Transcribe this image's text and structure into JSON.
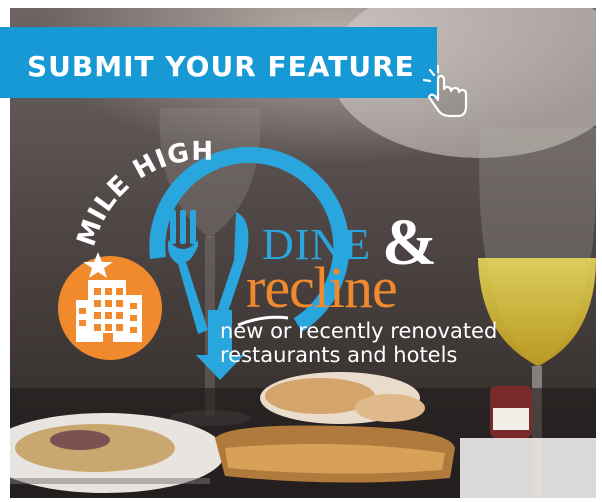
{
  "banner": {
    "title": "SUBMIT YOUR FEATURE",
    "color": "#1799d6"
  },
  "logo": {
    "arc_text": "MILE HIGH",
    "word_dine": "DINE",
    "word_amp": "&",
    "word_recline": "recline",
    "tagline_line1": "new or recently renovated",
    "tagline_line2": "restaurants and hotels",
    "colors": {
      "blue": "#2aa6de",
      "orange": "#f08a2c",
      "white": "#ffffff"
    }
  },
  "icons": [
    "pointing-hand-icon",
    "fork-icon",
    "knife-icon",
    "hotel-building-icon",
    "star-icon"
  ]
}
